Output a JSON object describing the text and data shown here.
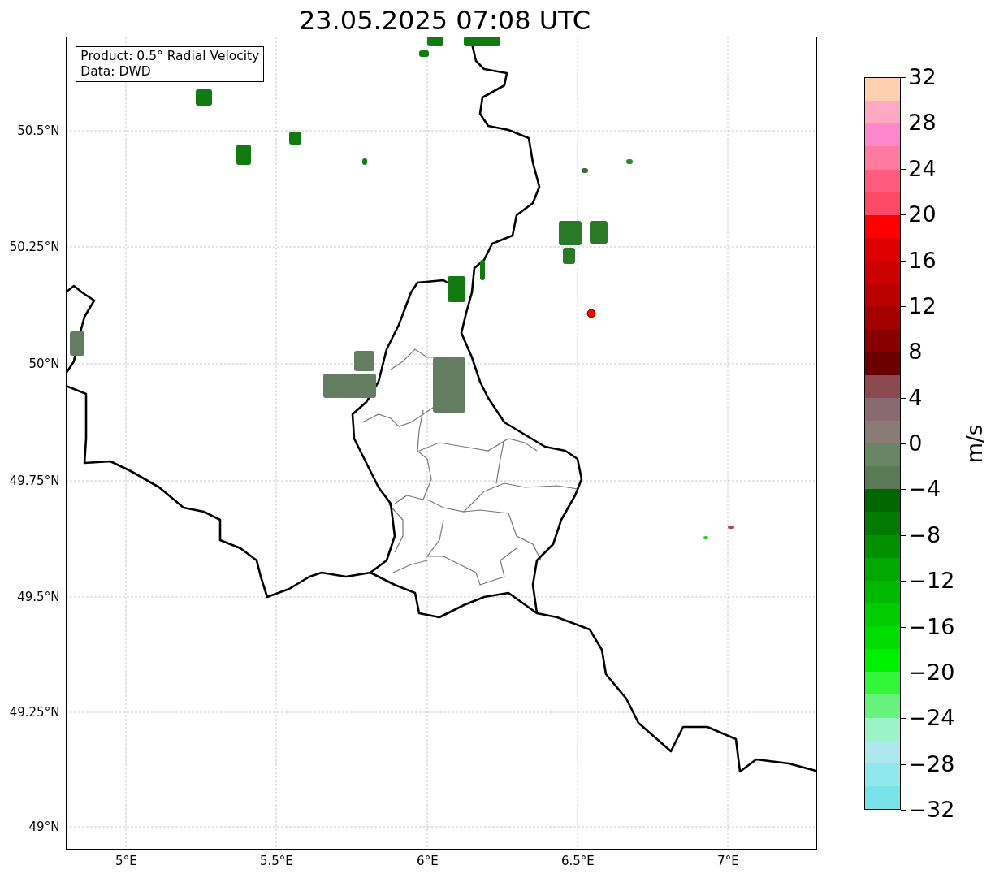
{
  "title": "23.05.2025 07:08 UTC",
  "map": {
    "info_box": [
      "Product: 0.5° Radial Velocity",
      "Data: DWD"
    ],
    "y_ticks": [
      "50.5°N",
      "50.25°N",
      "50°N",
      "49.75°N",
      "49.5°N",
      "49.25°N",
      "49°N"
    ],
    "x_ticks": [
      "5°E",
      "5.5°E",
      "6°E",
      "6.5°E",
      "7°E"
    ]
  },
  "colorbar": {
    "label": "m/s",
    "ticks": [
      "32",
      "28",
      "24",
      "20",
      "16",
      "12",
      "8",
      "4",
      "0",
      "−4",
      "−8",
      "−12",
      "−16",
      "−20",
      "−24",
      "−28",
      "−32"
    ],
    "bands": [
      {
        "color": "#77e3e8"
      },
      {
        "color": "#8ee8ec"
      },
      {
        "color": "#aee8ee"
      },
      {
        "color": "#9df3c8"
      },
      {
        "color": "#66f27d"
      },
      {
        "color": "#33f53a"
      },
      {
        "color": "#00f000"
      },
      {
        "color": "#00dc00"
      },
      {
        "color": "#00cc00"
      },
      {
        "color": "#00b800"
      },
      {
        "color": "#00a800"
      },
      {
        "color": "#009000"
      },
      {
        "color": "#007a00"
      },
      {
        "color": "#006600"
      },
      {
        "color": "#5a7a55"
      },
      {
        "color": "#6a8566"
      },
      {
        "color": "#8a7a78"
      },
      {
        "color": "#8a6a72"
      },
      {
        "color": "#8a4a50"
      },
      {
        "color": "#6a0000"
      },
      {
        "color": "#880000"
      },
      {
        "color": "#a50000"
      },
      {
        "color": "#bb0000"
      },
      {
        "color": "#cc0000"
      },
      {
        "color": "#dd0000"
      },
      {
        "color": "#ff0000"
      },
      {
        "color": "#ff4a66"
      },
      {
        "color": "#ff5c80"
      },
      {
        "color": "#ff7aa0"
      },
      {
        "color": "#ff88cc"
      },
      {
        "color": "#ffaac4"
      },
      {
        "color": "#ffd0b0"
      }
    ]
  }
}
